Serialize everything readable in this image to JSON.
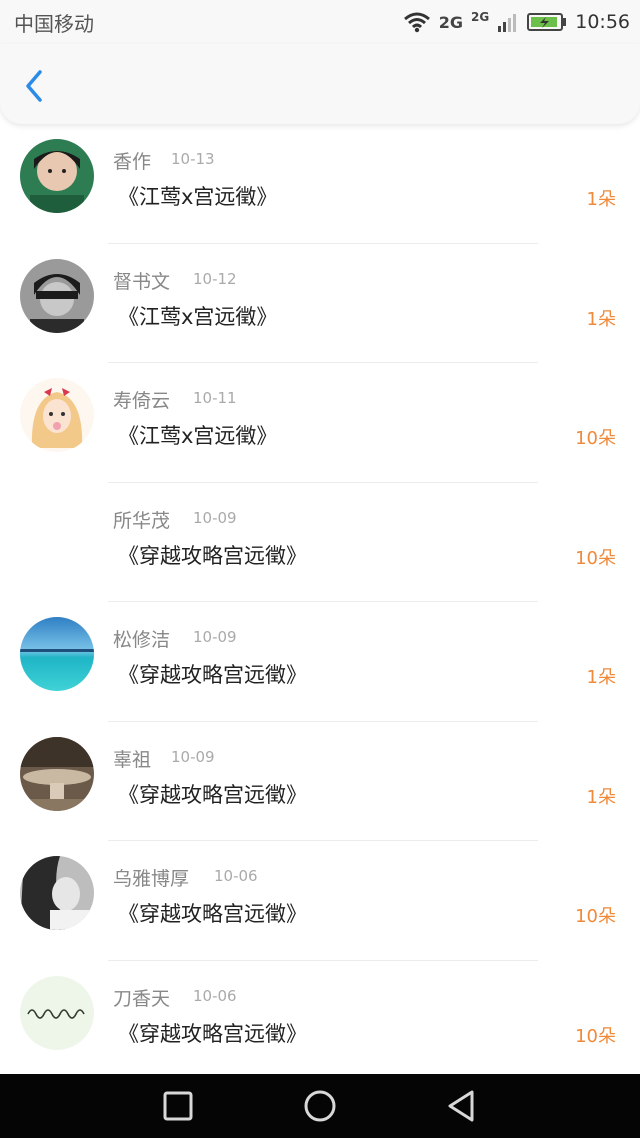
{
  "status_bar": {
    "carrier": "中国移动",
    "network_1": "2G",
    "network_2": "2G",
    "time": "10:56"
  },
  "header": {
    "back_icon": "chevron-left-icon"
  },
  "list": [
    {
      "name": "香作",
      "date": "10-13",
      "title": "《江莺x宫远徵》",
      "amount": "1朵",
      "avatar": "avatar-girl-green"
    },
    {
      "name": "督书文",
      "date": "10-12",
      "title": "《江莺x宫远徵》",
      "amount": "1朵",
      "avatar": "avatar-boy-bw"
    },
    {
      "name": "寿倚云",
      "date": "10-11",
      "title": "《江莺x宫远徵》",
      "amount": "10朵",
      "avatar": "avatar-cartoon-girl"
    },
    {
      "name": "所华茂",
      "date": "10-09",
      "title": "《穿越攻略宫远徵》",
      "amount": "10朵",
      "avatar": ""
    },
    {
      "name": "松修洁",
      "date": "10-09",
      "title": "《穿越攻略宫远徵》",
      "amount": "1朵",
      "avatar": "avatar-pool"
    },
    {
      "name": "辜祖",
      "date": "10-09",
      "title": "《穿越攻略宫远徵》",
      "amount": "1朵",
      "avatar": "avatar-sepia"
    },
    {
      "name": "乌雅博厚",
      "date": "10-06",
      "title": "《穿越攻略宫远徵》",
      "amount": "10朵",
      "avatar": "avatar-girl-bw"
    },
    {
      "name": "刀香天",
      "date": "10-06",
      "title": "《穿越攻略宫远徵》",
      "amount": "10朵",
      "avatar": "avatar-handwriting"
    }
  ],
  "nav_bar": {
    "recent_icon": "square-icon",
    "home_icon": "circle-icon",
    "back_icon": "triangle-back-icon"
  },
  "colors": {
    "accent_blue": "#2a8ce8",
    "amount_orange": "#f08a3a"
  }
}
